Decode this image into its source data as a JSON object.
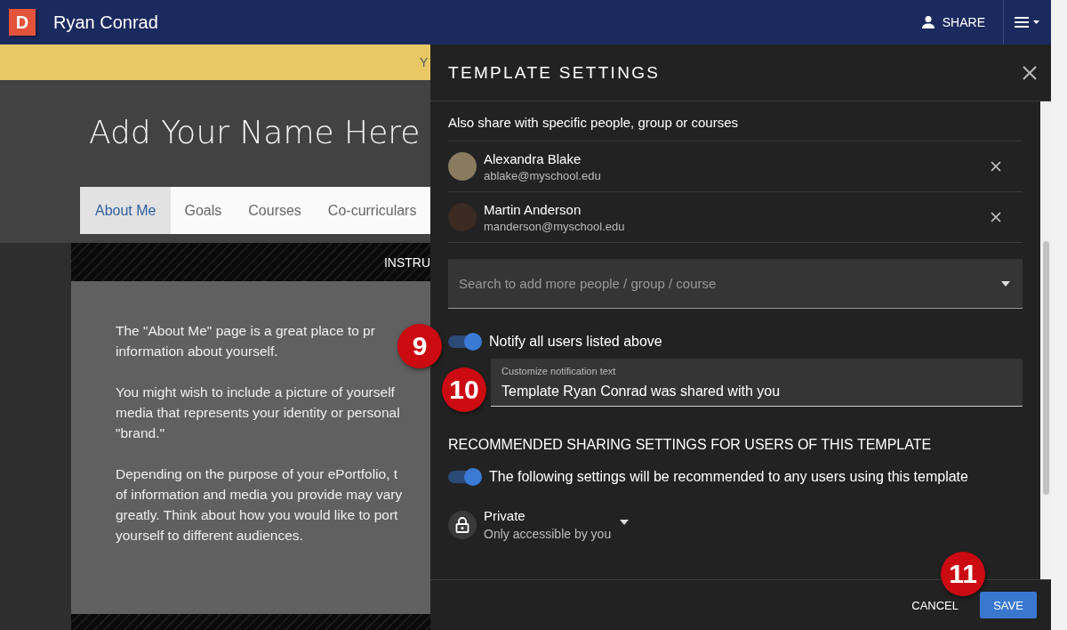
{
  "app_bar": {
    "logo": "D",
    "title": "Ryan Conrad",
    "share_button": "SHARE"
  },
  "banner": {
    "text": "Y"
  },
  "portfolio": {
    "name": "Add Your Name Here",
    "tabs": [
      {
        "label": "About Me",
        "selected": true
      },
      {
        "label": "Goals",
        "selected": false
      },
      {
        "label": "Courses",
        "selected": false
      },
      {
        "label": "Co-curriculars",
        "selected": false
      }
    ],
    "section_heading": "INSTRU",
    "paragraphs": [
      [
        "The \"About Me\" page is a great place to pr",
        "information about yourself."
      ],
      [
        "You might wish to include a picture of yourself",
        "media that represents your identity or personal",
        "\"brand.\""
      ],
      [
        "Depending on the purpose of your ePortfolio, t",
        "of information and media you provide may vary",
        "greatly. Think about how you would like to port",
        "yourself to different audiences."
      ]
    ]
  },
  "drawer": {
    "title": "TEMPLATE SETTINGS",
    "share_heading": "Also share with specific people, group or courses",
    "people": [
      {
        "name": "Alexandra Blake",
        "email": "ablake@myschool.edu"
      },
      {
        "name": "Martin Anderson",
        "email": "manderson@myschool.edu"
      }
    ],
    "search": {
      "placeholder": "Search to add more people / group / course"
    },
    "notify": {
      "label": "Notify all users listed above",
      "on": true
    },
    "notification_text": {
      "label": "Customize notification text",
      "value": "Template Ryan Conrad was shared with you"
    },
    "recommended_heading": "RECOMMENDED SHARING SETTINGS FOR USERS OF THIS TEMPLATE",
    "recommend": {
      "label": "The following settings will be recommended to any users using this template",
      "on": true
    },
    "visibility": {
      "title": "Private",
      "subtitle": "Only accessible by you"
    },
    "buttons": {
      "cancel": "CANCEL",
      "save": "SAVE"
    }
  },
  "callouts": [
    "9",
    "10",
    "11"
  ]
}
